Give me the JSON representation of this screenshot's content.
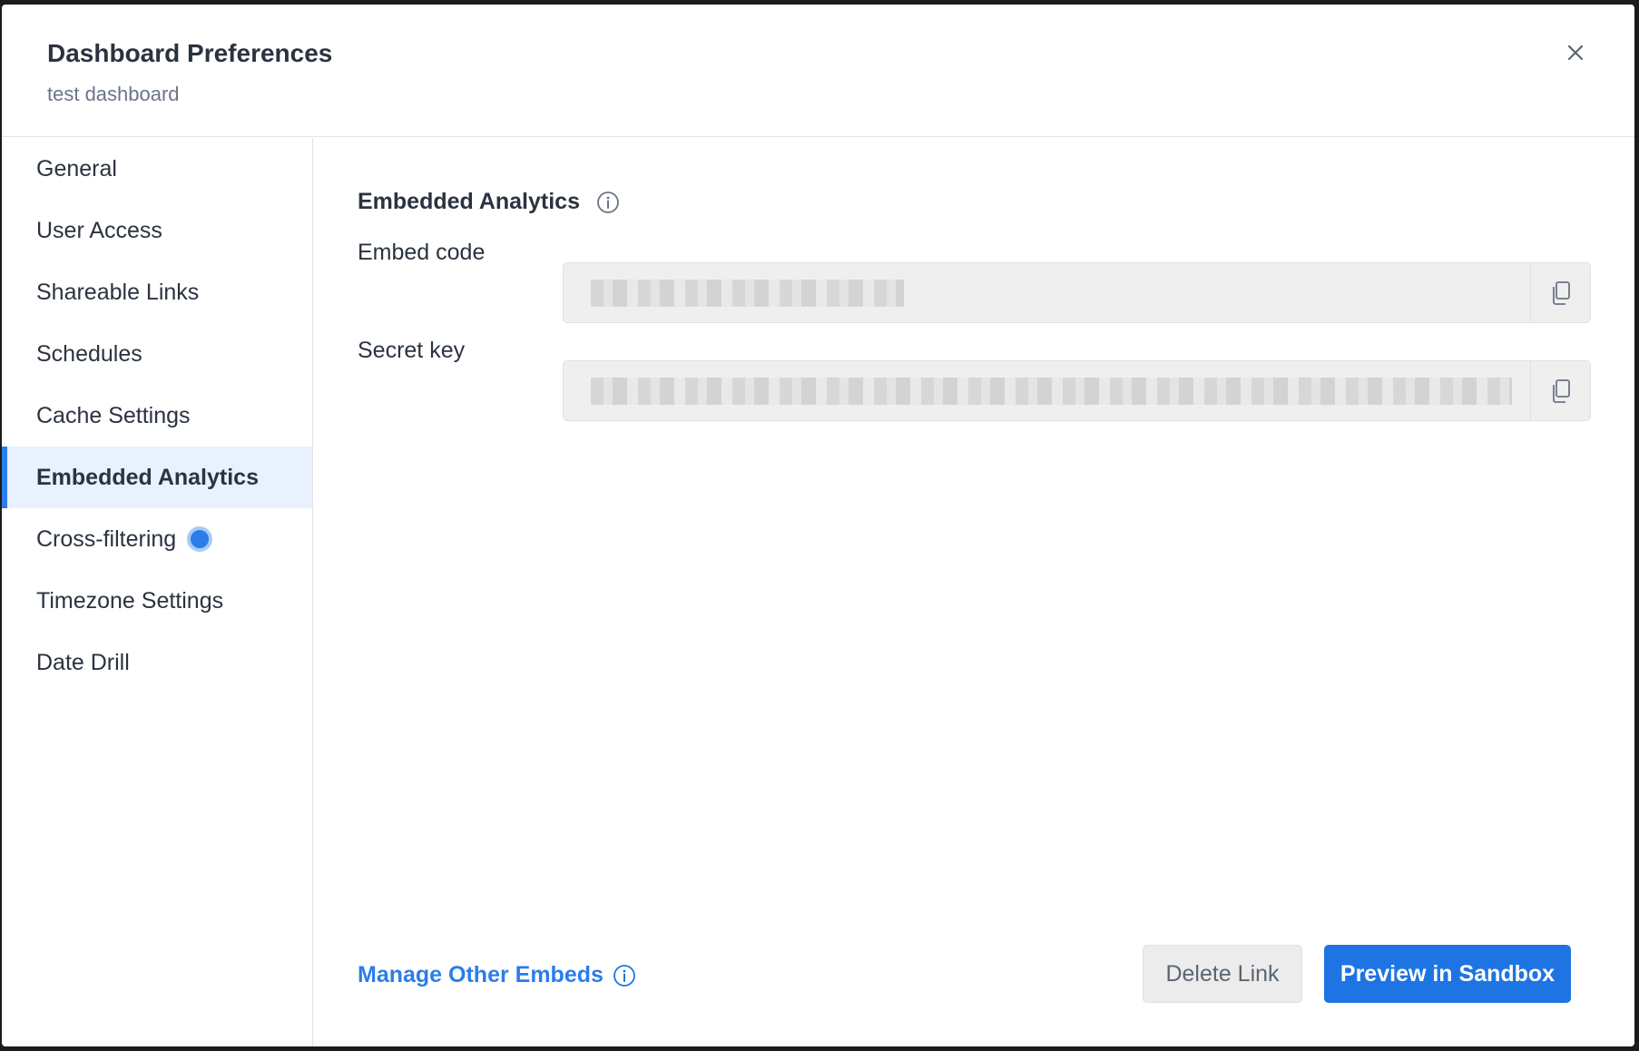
{
  "dialog": {
    "title": "Dashboard Preferences",
    "subtitle": "test dashboard"
  },
  "sidebar": {
    "items": [
      {
        "label": "General"
      },
      {
        "label": "User Access"
      },
      {
        "label": "Shareable Links"
      },
      {
        "label": "Schedules"
      },
      {
        "label": "Cache Settings"
      },
      {
        "label": "Embedded Analytics",
        "active": true
      },
      {
        "label": "Cross-filtering",
        "badge_dot": true
      },
      {
        "label": "Timezone Settings"
      },
      {
        "label": "Date Drill"
      }
    ]
  },
  "main": {
    "section_title": "Embedded Analytics",
    "embed_code": {
      "label": "Embed code",
      "value": ""
    },
    "secret_key": {
      "label": "Secret key",
      "value": ""
    },
    "manage_link": "Manage Other Embeds",
    "delete_button": "Delete Link",
    "preview_button": "Preview in Sandbox"
  },
  "colors": {
    "accent": "#1f74e3",
    "active_bg": "#e8f1fd",
    "text": "#2b3340",
    "muted": "#6b7586"
  },
  "icons": {
    "close": "close-icon",
    "info": "info-icon",
    "copy": "copy-icon"
  }
}
